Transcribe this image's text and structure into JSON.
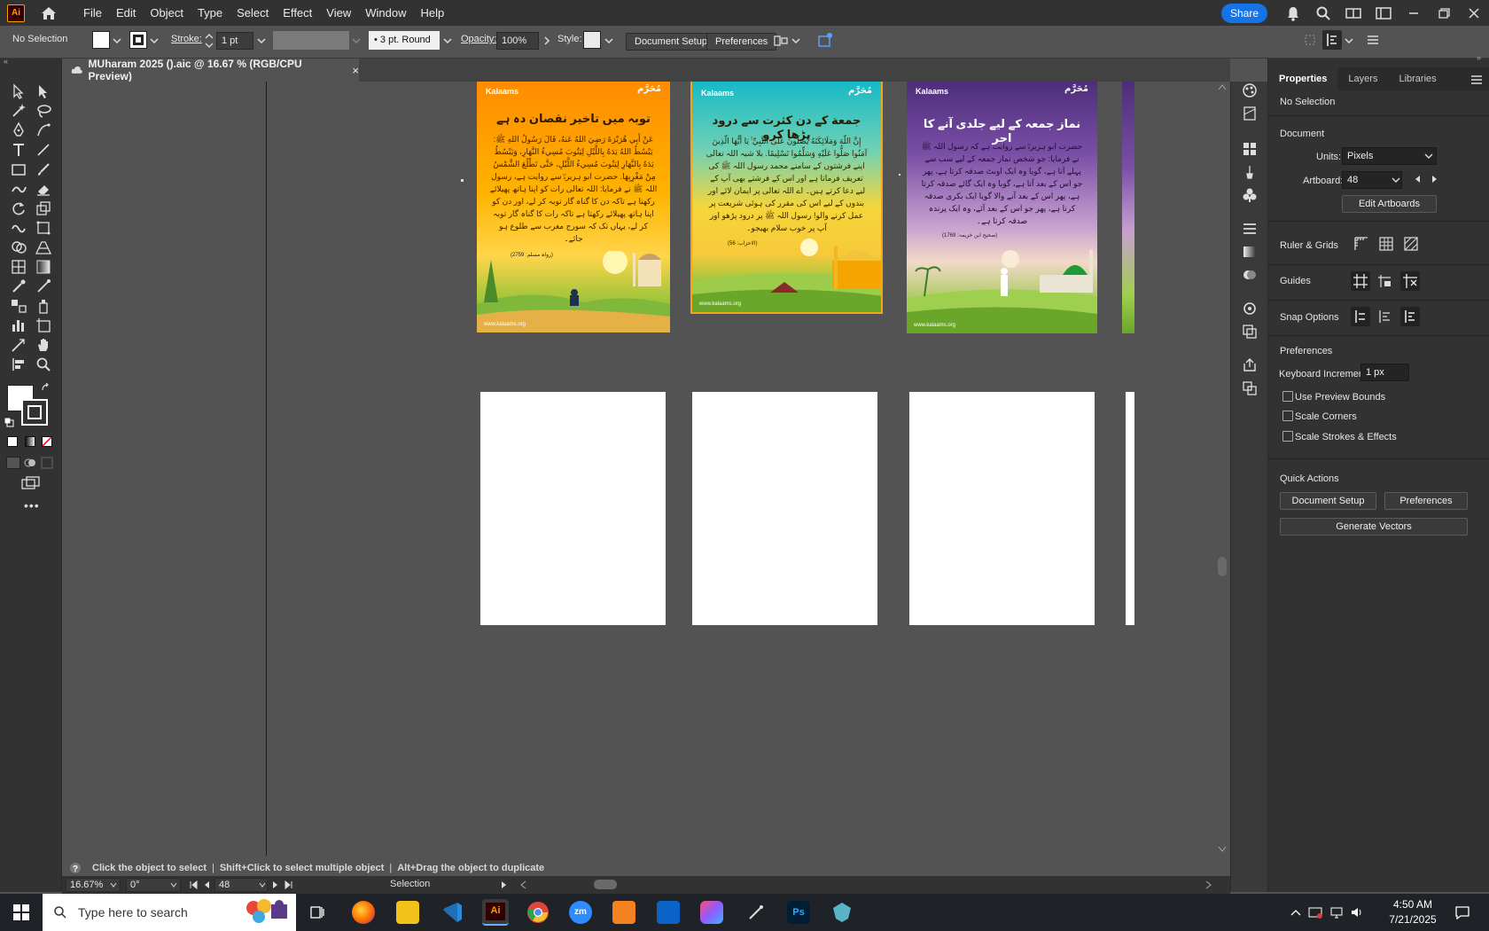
{
  "app": {
    "logo": "Ai",
    "home_icon": "home-icon"
  },
  "menu": [
    "File",
    "Edit",
    "Object",
    "Type",
    "Select",
    "Effect",
    "View",
    "Window",
    "Help"
  ],
  "topright": {
    "share_label": "Share"
  },
  "controlbar": {
    "selection": "No Selection",
    "stroke_label": "Stroke:",
    "stroke_value": "1 pt",
    "brush_value": "3 pt. Round",
    "opacity_label": "Opacity:",
    "opacity_value": "100%",
    "style_label": "Style:",
    "document_setup": "Document Setup",
    "preferences": "Preferences"
  },
  "document_tab": {
    "title": "MUharam 2025 ().aic @ 16.67 % (RGB/CPU Preview)",
    "close": "×"
  },
  "posters": [
    {
      "brand": "Kalaams",
      "badge": "مُحَرَّم",
      "title": "توبہ میں تاخیر نقصان دہ ہے",
      "text": "عَنْ أَبِي هُرَيْرَةَ رَضِيَ اللهُ عَنهُ، قَالَ رَسُولُ اللهِ ﷺ: يَبْسُطُ اللهُ يَدَهُ بِاللَّيْلِ لِيَتُوبَ مُسِيءُ النَّهَارِ، وَيَبْسُطُ يَدَهُ بِالنَّهَارِ لِيَتُوبَ مُسِيءُ اللَّيْلِ، حَتَّى تَطْلُعَ الشَّمْسُ مِنْ مَغْرِبِهَا. حضرت ابو ہریرہؓ سے روایت ہے، رسول اللہ ﷺ نے فرمایا: اللہ تعالی رات کو اپنا ہاتھ پھیلائے رکھتا ہے تاکہ دن کا گناہ گار توبہ کر لے، اور دن کو اپنا ہاتھ پھیلائے رکھتا ہے تاکہ رات کا گناہ گار توبہ کر لے، یہاں تک کہ سورج مغرب سے طلوع ہو جائے۔",
      "ref": "(رواہ مسلم: 2759)",
      "footer": "www.kalaams.org"
    },
    {
      "brand": "Kalaams",
      "badge": "مُحَرَّم",
      "title": "جمعة کے دن کثرت سے درود پڑھا کرو",
      "text": "إِنَّ اللَّهَ وَمَلَائِكَتَهُ يُصَلُّونَ عَلَى النَّبِيِّ ۚ يَا أَيُّهَا الَّذِينَ آمَنُوا صَلُّوا عَلَيْهِ وَسَلِّمُوا تَسْلِيمًا. بلا شبہ اللہ تعالی اپنے فرشتوں کے سامنے محمد رسول اللہ ﷺ کی تعریف فرماتا ہے اور اس کے فرشتے بھی آپ کے لیے دعا کرتے ہیں۔ اے اللہ تعالی پر ایمان لائے اور بندوں کے لیے اس کی مقرر کی ہوئی شریعت پر عمل کرنے والو! رسول اللہ ﷺ پر درود پڑھو اور آپ پر خوب سلام بھیجو۔",
      "ref": "(الاحزاب: 56)",
      "footer": "www.kalaams.org"
    },
    {
      "brand": "Kalaams",
      "badge": "مُحَرَّم",
      "title": "نماز جمعہ کے لیے جلدی آنے کا اجر",
      "text": "حضرت ابو ہریرہؓ سے روایت ہے کہ رسول اللہ ﷺ نے فرمایا: جو شخص نماز جمعہ کے لیے سب سے پہلے آتا ہے، گویا وہ ایک اونٹ صدقہ کرتا ہے، پھر جو اس کے بعد آتا ہے، گویا وہ ایک گائے صدقہ کرتا ہے، پھر اس کے بعد آنے والا گویا ایک بکری صدقہ کرتا ہے، پھر جو اس کے بعد آئے، وہ ایک پرندہ صدقہ کرتا ہے۔",
      "ref": "(صحیح ابن خزیمہ: 1769)",
      "footer": "www.kalaams.org"
    }
  ],
  "properties": {
    "tabs": [
      "Properties",
      "Layers",
      "Libraries"
    ],
    "selection": "No Selection",
    "document_heading": "Document",
    "units_label": "Units:",
    "units_value": "Pixels",
    "artboard_label": "Artboard:",
    "artboard_value": "48",
    "edit_artboards": "Edit Artboards",
    "ruler_grids": "Ruler & Grids",
    "guides": "Guides",
    "snap_options": "Snap Options",
    "preferences_heading": "Preferences",
    "keyboard_increment_label": "Keyboard Increment:",
    "keyboard_increment_value": "1 px",
    "use_preview_bounds": "Use Preview Bounds",
    "scale_corners": "Scale Corners",
    "scale_strokes_effects": "Scale Strokes & Effects",
    "quick_actions": "Quick Actions",
    "document_setup": "Document Setup",
    "preferences": "Preferences",
    "generate_vectors": "Generate Vectors"
  },
  "hint": {
    "text1": "Click the object to select",
    "sep": "|",
    "text2": "Shift+Click to select multiple object",
    "text3": "Alt+Drag the object to duplicate"
  },
  "statusbar": {
    "zoom": "16.67%",
    "rotation": "0°",
    "artboard": "48",
    "tool": "Selection"
  },
  "taskbar": {
    "search_placeholder": "Type here to search",
    "time": "4:50 AM",
    "date": "7/21/2025"
  },
  "colors": {
    "accent": "#1473e6",
    "ai_orange": "#ff9a00"
  }
}
